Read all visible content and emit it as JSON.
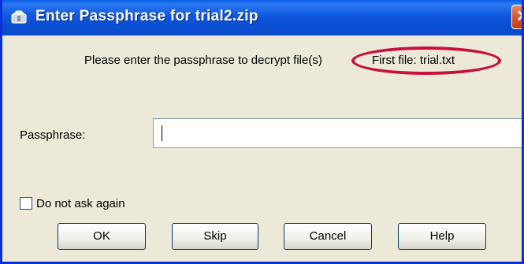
{
  "window": {
    "title": "Enter Passphrase for trial2.zip",
    "close_symbol": "✕"
  },
  "dialog": {
    "prompt": "Please enter the passphrase to decrypt file(s)",
    "first_file": "First file: trial.txt",
    "passphrase_label": "Passphrase:",
    "passphrase_value": "",
    "checkbox_label": "Do not ask again",
    "checkbox_checked": false
  },
  "buttons": {
    "ok": "OK",
    "skip": "Skip",
    "cancel": "Cancel",
    "help": "Help"
  },
  "colors": {
    "titlebar": "#0a4fd3",
    "annotation_ellipse": "#c8103c",
    "dialog_bg": "#ece9d8"
  },
  "icons": {
    "app": "archive-app-icon",
    "close": "close-icon"
  }
}
